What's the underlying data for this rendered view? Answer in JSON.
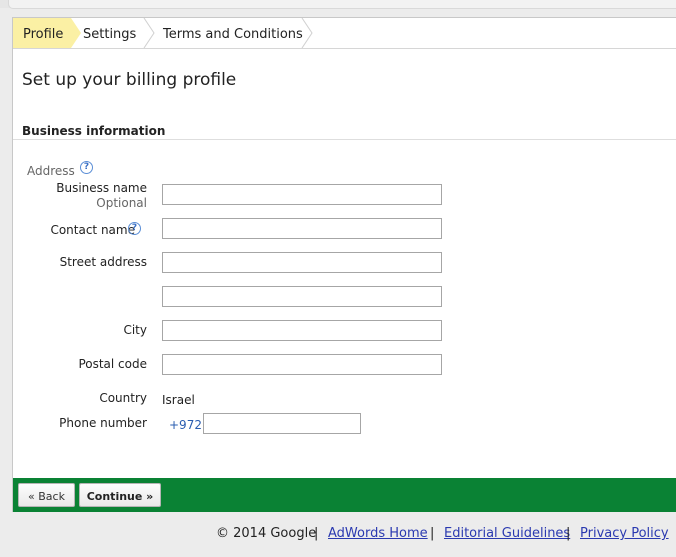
{
  "steps": [
    {
      "label": "Profile"
    },
    {
      "label": "Settings"
    },
    {
      "label": "Terms and Conditions"
    }
  ],
  "page_title": "Set up your billing profile",
  "section_title": "Business information",
  "form": {
    "address_label": "Address",
    "help_glyph": "?",
    "business_name_label": "Business name",
    "optional_label": "Optional",
    "contact_name_label": "Contact name",
    "street_address_label": "Street address",
    "city_label": "City",
    "postal_code_label": "Postal code",
    "country_label": "Country",
    "country_value": "Israel",
    "phone_label": "Phone number",
    "phone_code": "+972",
    "business_name_value": "",
    "contact_name_value": "",
    "street_address_1_value": "",
    "street_address_2_value": "",
    "city_value": "",
    "postal_code_value": "",
    "phone_value": ""
  },
  "buttons": {
    "back_label": "« Back",
    "continue_label": "Continue »"
  },
  "footer": {
    "copyright": "© 2014 Google",
    "separator": "|",
    "links": [
      "AdWords Home",
      "Editorial Guidelines",
      "Privacy Policy"
    ]
  },
  "colors": {
    "active_step": "#fbf0a4",
    "action_bar": "#0a8234",
    "link": "#2a39b0",
    "help_icon": "#3a6fc4"
  }
}
